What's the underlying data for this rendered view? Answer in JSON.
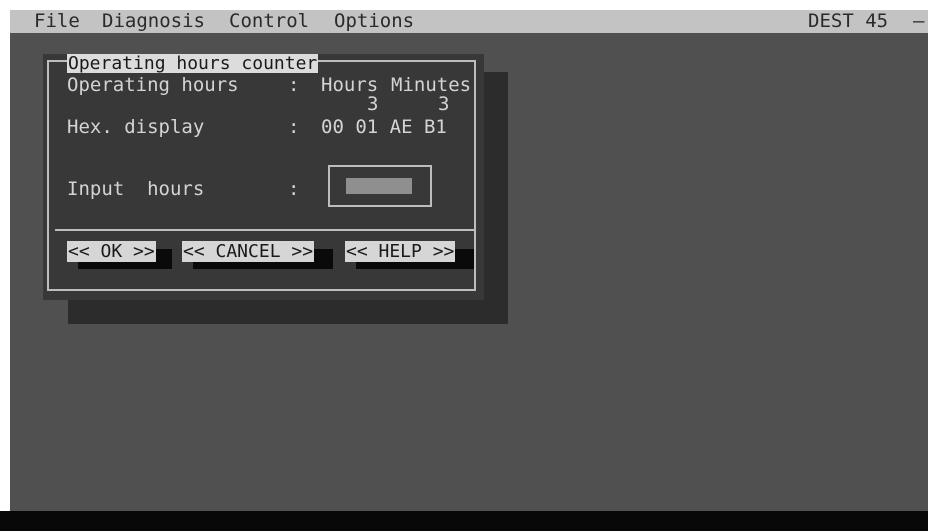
{
  "menubar": {
    "items": [
      "File",
      "Diagnosis",
      "Control",
      "Options"
    ],
    "right_label": "DEST 45",
    "right_dash": "–"
  },
  "dialog": {
    "title": "Operating hours counter",
    "operating_hours_label": "Operating hours",
    "colon": ":",
    "hours_header": "Hours",
    "minutes_header": "Minutes",
    "hours_value": "3",
    "minutes_value": "3",
    "hex_label": "Hex. display",
    "hex_value": "00 01 AE B1",
    "input_label": "Input  hours",
    "input_value": ""
  },
  "buttons": {
    "ok": "<< OK >>",
    "cancel": "<< CANCEL >>",
    "help": "<< HELP >>"
  }
}
